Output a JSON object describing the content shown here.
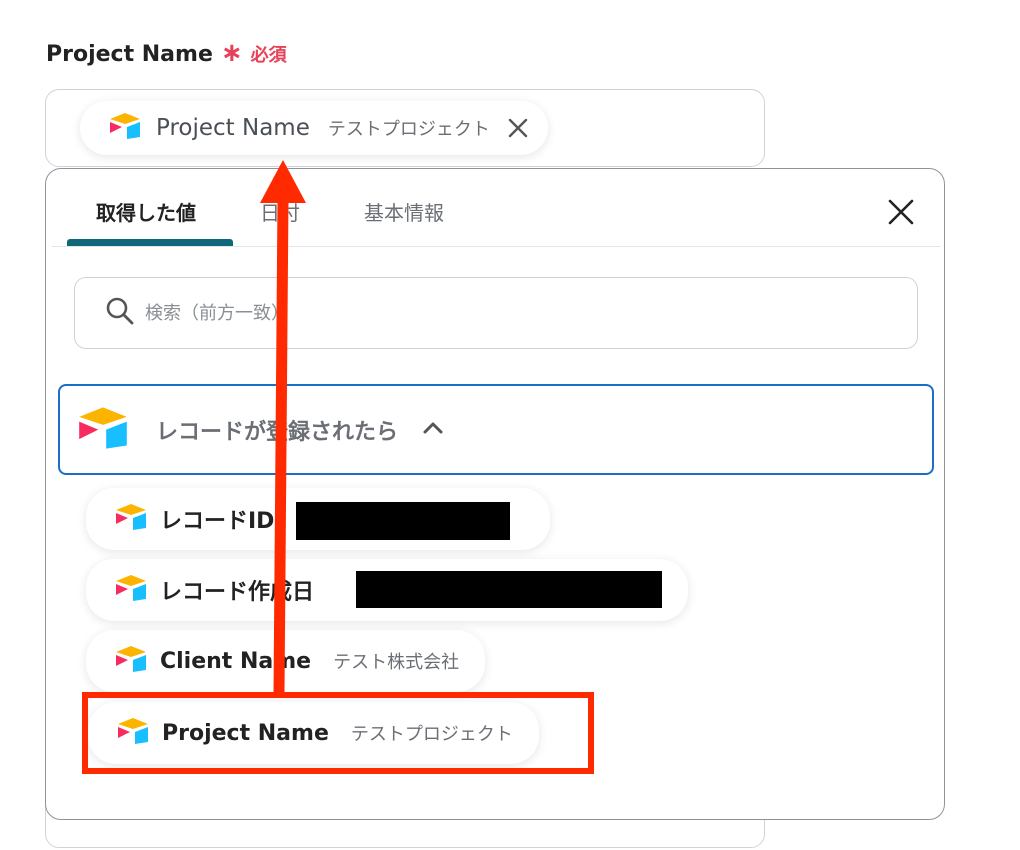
{
  "field": {
    "label": "Project Name",
    "required_star": "∗",
    "required_text": "必須"
  },
  "selected": {
    "label": "Project Name",
    "value": "テストプロジェクト",
    "icon": "airtable-icon",
    "remove_icon": "close-icon"
  },
  "panel": {
    "tabs": [
      {
        "label": "取得した値",
        "active": true
      },
      {
        "label": "日付",
        "active": false
      },
      {
        "label": "基本情報",
        "active": false
      }
    ],
    "close_icon": "close-icon",
    "search": {
      "placeholder": "検索（前方一致）",
      "value": ""
    },
    "group": {
      "title": "レコードが登録されたら",
      "icon": "airtable-icon",
      "expanded": true
    },
    "items": [
      {
        "label": "レコードID",
        "value": "",
        "redacted": true
      },
      {
        "label": "レコード作成日",
        "value": "",
        "redacted": true
      },
      {
        "label": "Client Name",
        "value": "テスト株式会社",
        "redacted": false
      },
      {
        "label": "Project Name",
        "value": "テストプロジェクト",
        "redacted": false,
        "highlighted": true
      }
    ]
  },
  "colors": {
    "required": "#e8425a",
    "tab_underline": "#10677a",
    "group_border": "#1b6fc7",
    "annotation": "#ff2a00"
  }
}
